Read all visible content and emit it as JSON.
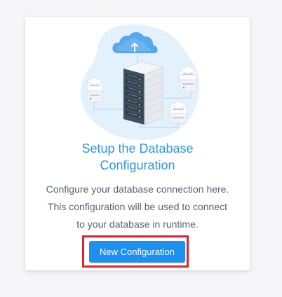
{
  "card": {
    "title_line1": "Setup the Database",
    "title_line2": "Configuration",
    "description_line1": "Configure your database connection here.",
    "description_line2": "This configuration will be used to connect",
    "description_line3": "to your database in runtime.",
    "button_label": "New Configuration"
  },
  "colors": {
    "accent": "#2f96e0",
    "button": "#1e90ef",
    "highlight": "#e3222e",
    "blob": "#e3f1fc"
  },
  "illustration": {
    "icons": [
      "cloud-upload-icon",
      "server-rack-icon"
    ]
  }
}
